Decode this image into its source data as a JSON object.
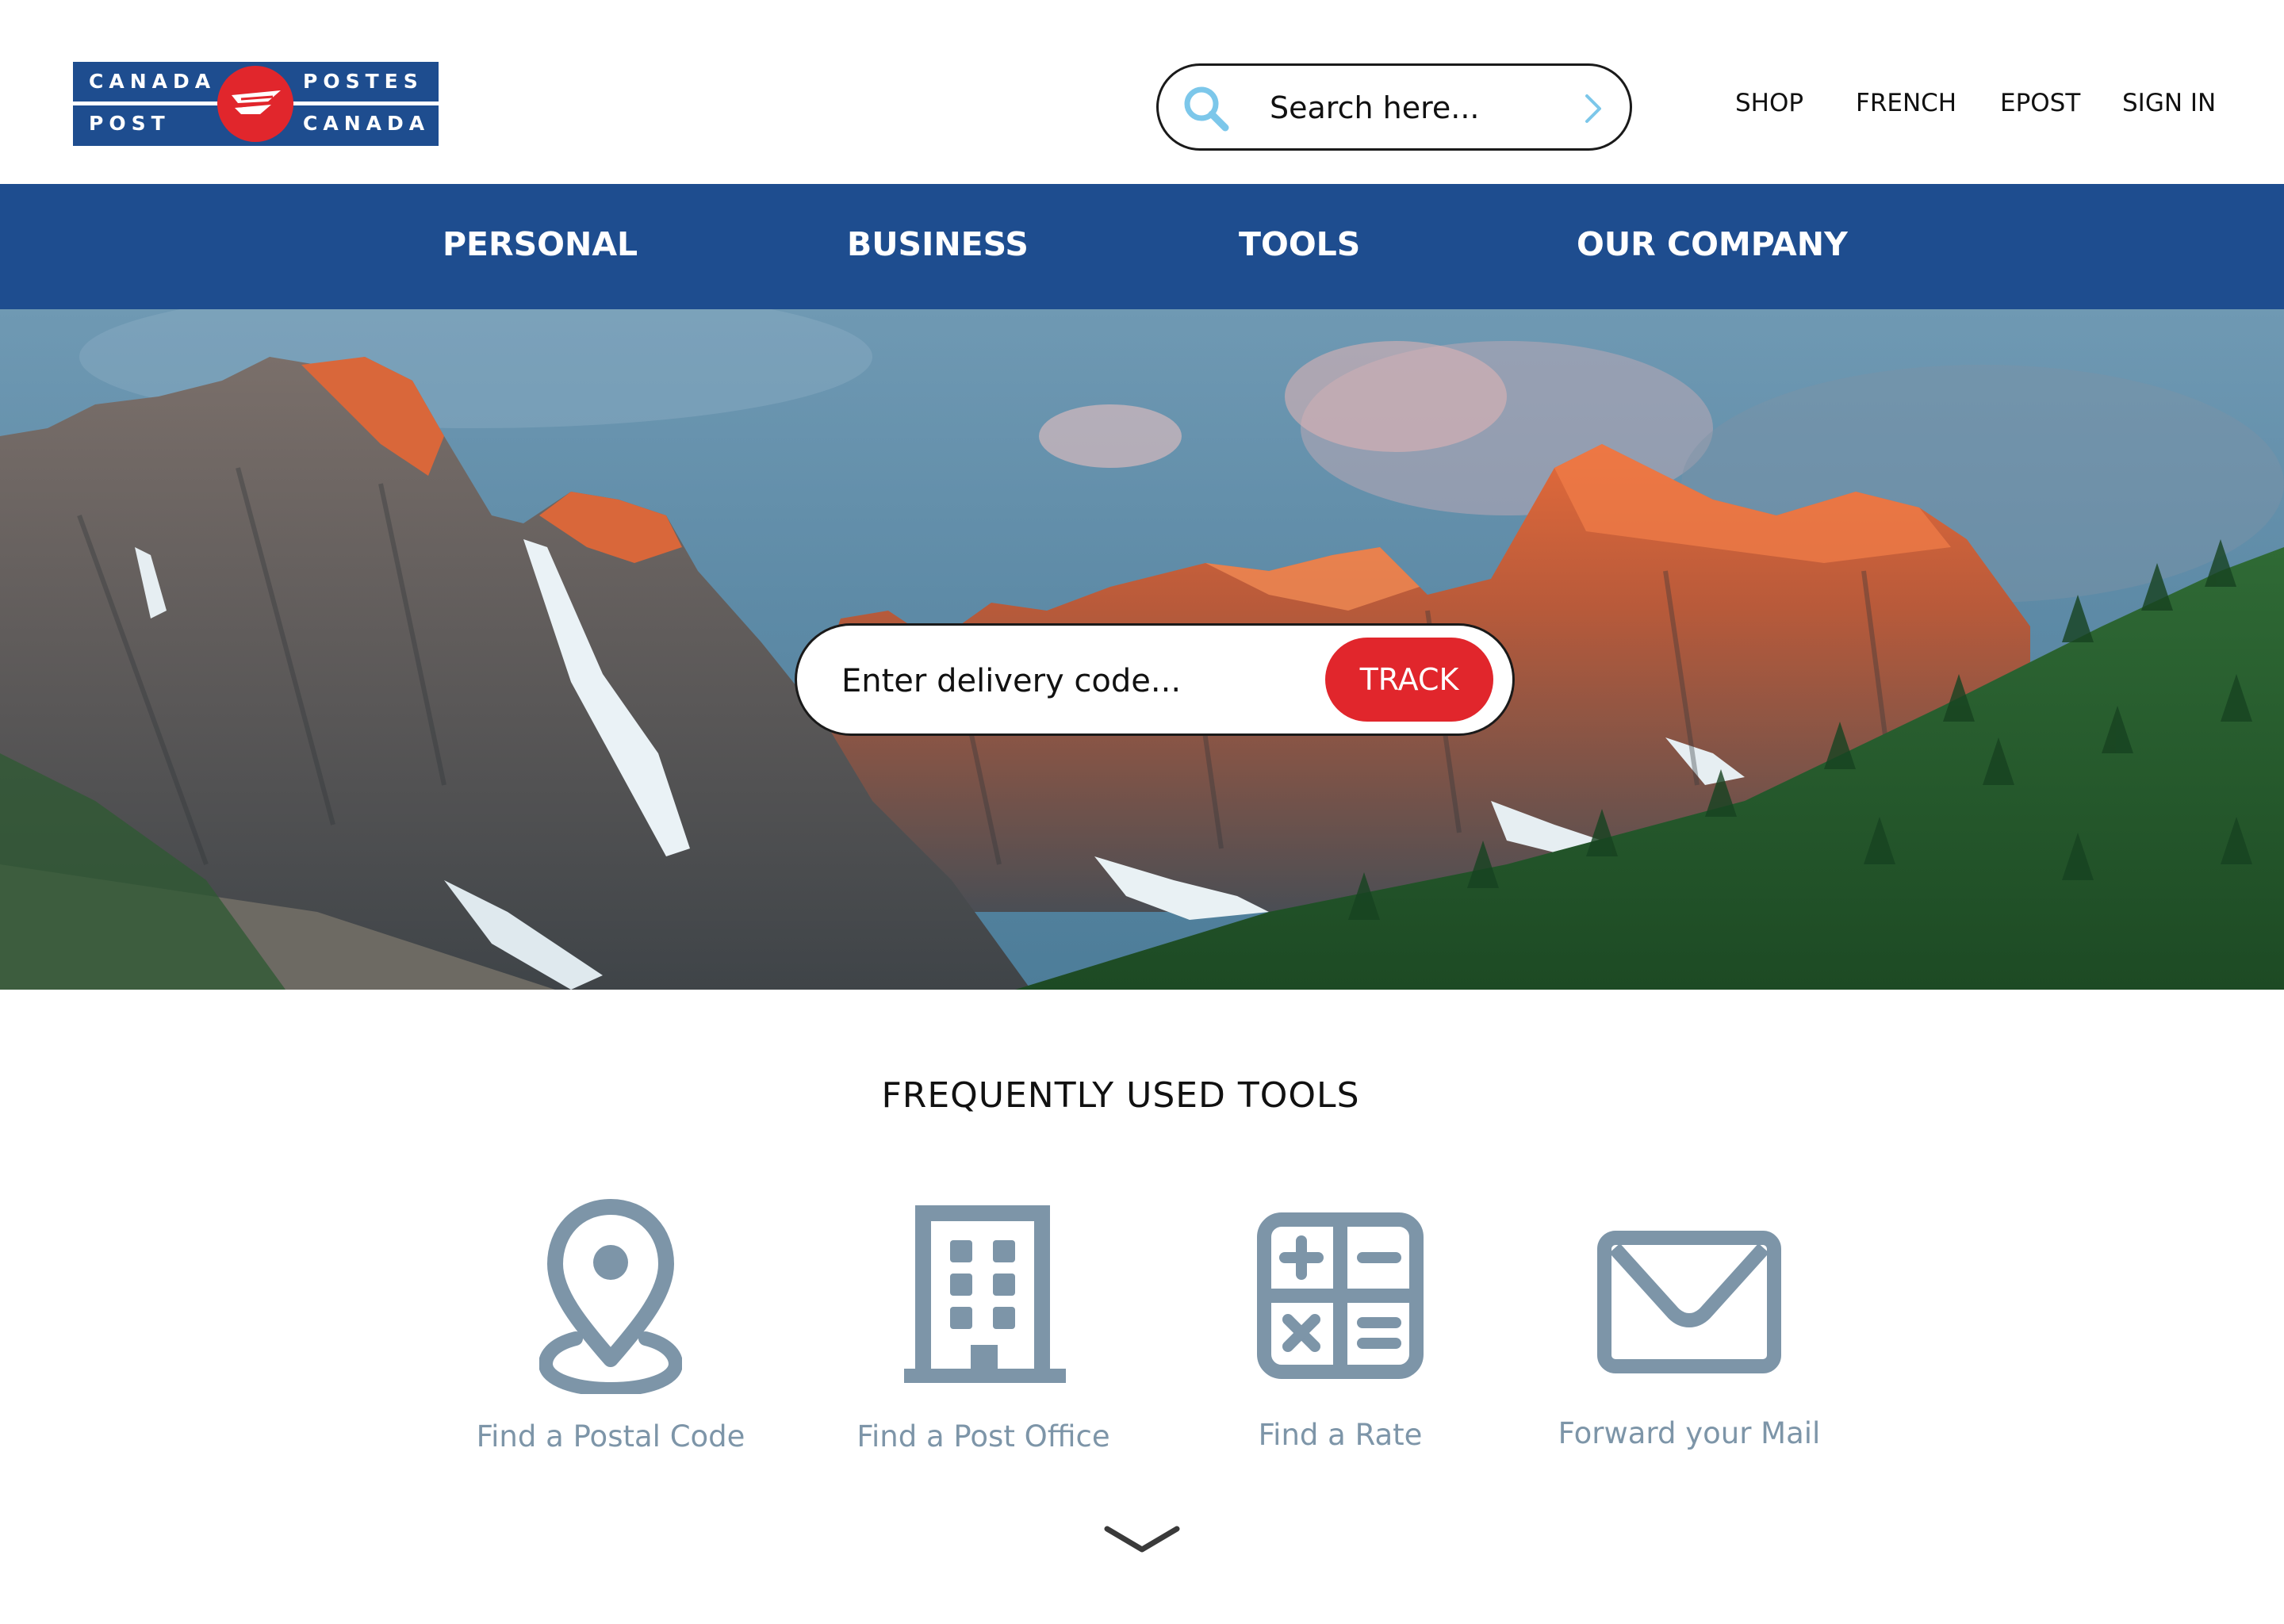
{
  "brand": {
    "logo_line1_left": "CANADA",
    "logo_line2_left": "POST",
    "logo_line1_right": "POSTES",
    "logo_line2_right": "CANADA",
    "primary_color": "#1e4d8f",
    "accent_color": "#e1262c"
  },
  "search": {
    "placeholder": "Search here...",
    "icon": "search-icon",
    "submit_icon": "chevron-right-icon"
  },
  "utility_nav": {
    "shop": "SHOP",
    "french": "FRENCH",
    "epost": "EPOST",
    "sign_in": "SIGN IN"
  },
  "main_nav": {
    "personal": "PERSONAL",
    "business": "BUSINESS",
    "tools": "TOOLS",
    "our_company": "OUR COMPANY"
  },
  "hero": {
    "image": "mountain-landscape",
    "track_placeholder": "Enter delivery code...",
    "track_button": "TRACK"
  },
  "tools_section": {
    "title": "FREQUENTLY USED TOOLS",
    "icon_color": "#7d95a8",
    "items": [
      {
        "label": "Find a Postal Code",
        "icon": "map-pin-icon"
      },
      {
        "label": "Find a Post Office",
        "icon": "building-icon"
      },
      {
        "label": "Find a Rate",
        "icon": "calculator-icon"
      },
      {
        "label": "Forward your Mail",
        "icon": "envelope-icon"
      }
    ],
    "more_icon": "chevron-down-icon"
  }
}
